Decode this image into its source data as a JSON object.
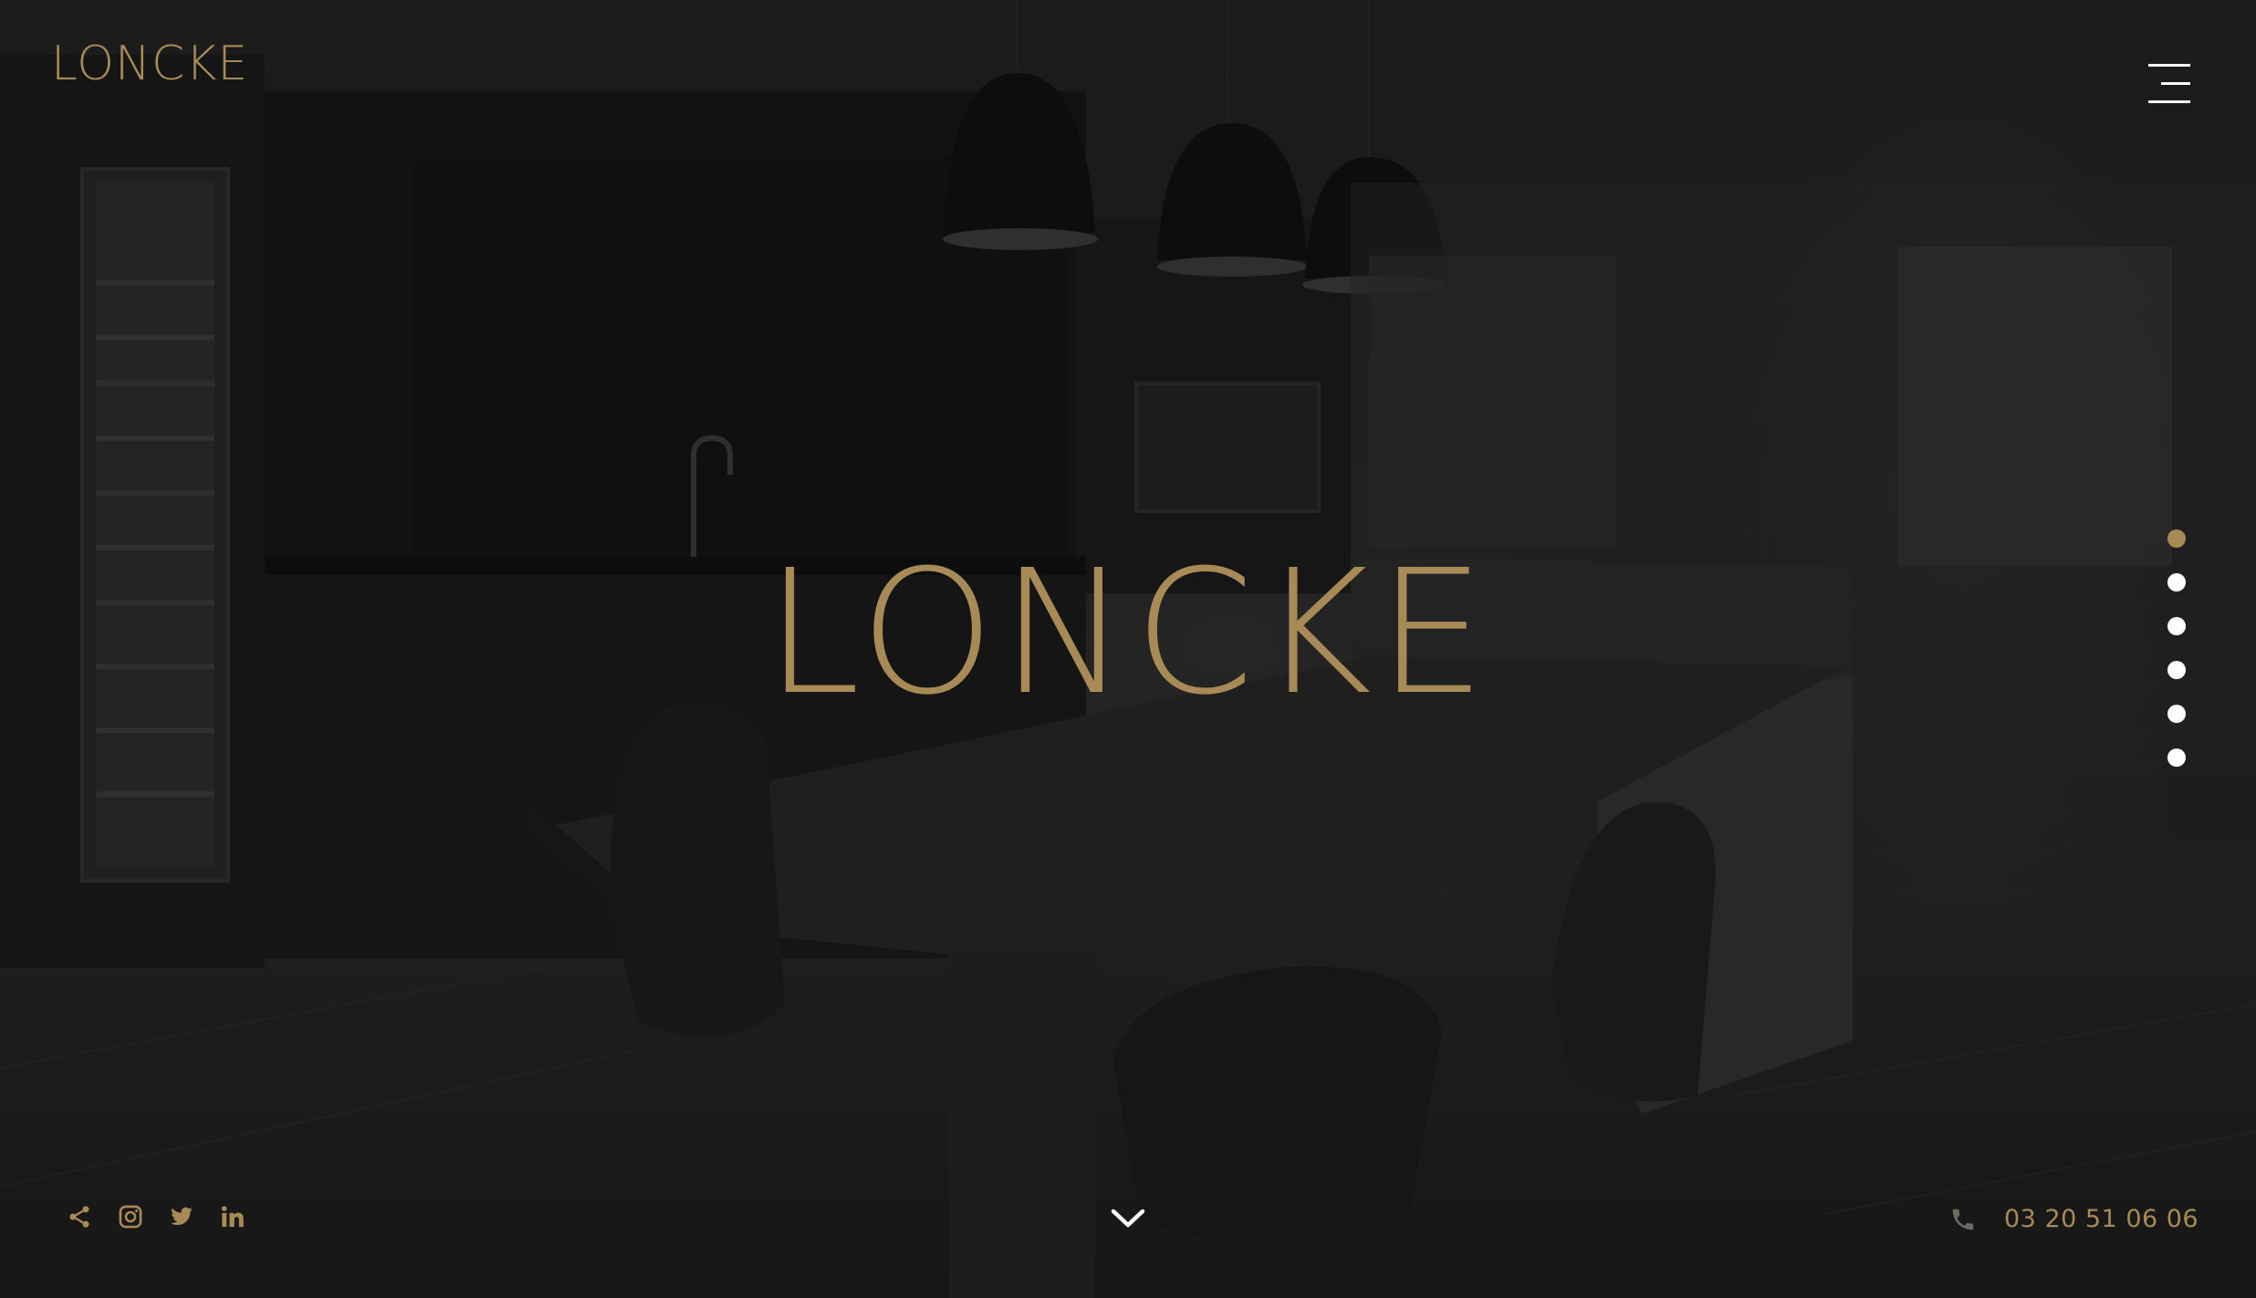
{
  "header": {
    "logo": "LONCKE",
    "menu_icon": "hamburger-menu-icon"
  },
  "hero": {
    "title": "LONCKE"
  },
  "slides": {
    "count": 6,
    "active_index": 0
  },
  "social": [
    {
      "name": "share",
      "icon": "share-icon"
    },
    {
      "name": "instagram",
      "icon": "instagram-icon"
    },
    {
      "name": "twitter",
      "icon": "twitter-icon"
    },
    {
      "name": "linkedin",
      "icon": "linkedin-icon"
    }
  ],
  "footer": {
    "scroll_icon": "chevron-down-icon",
    "phone_icon": "phone-icon",
    "phone": "03 20 51 06 06"
  },
  "colors": {
    "accent": "#a88a56",
    "background": "#1d1d1d",
    "dot": "#ffffff"
  }
}
